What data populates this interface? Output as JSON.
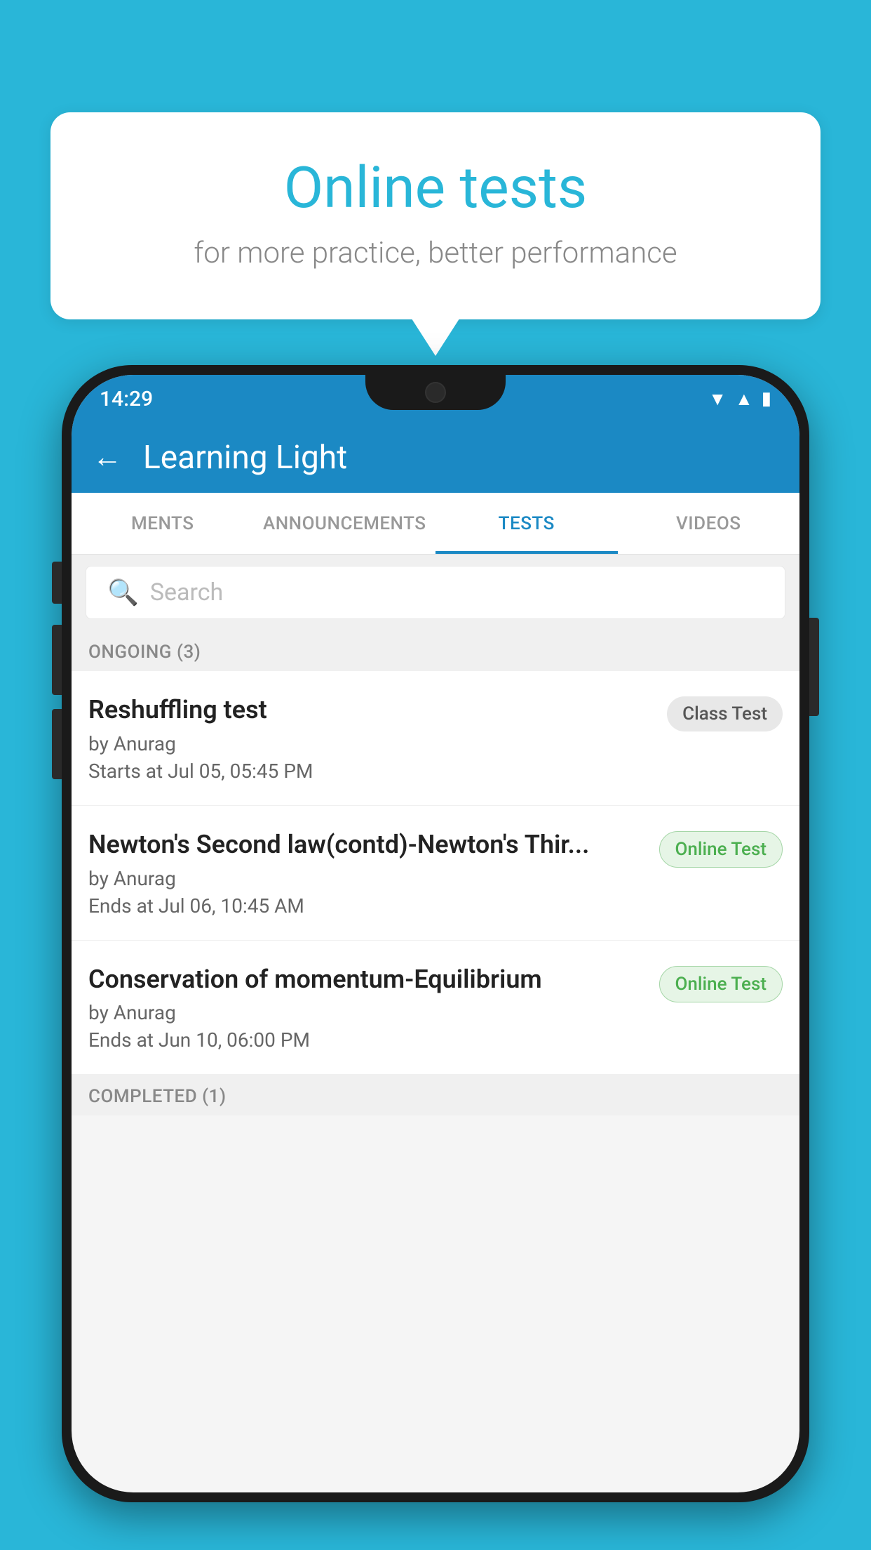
{
  "background_color": "#29b6d8",
  "bubble": {
    "title": "Online tests",
    "subtitle": "for more practice, better performance"
  },
  "status_bar": {
    "time": "14:29",
    "icons": [
      "wifi",
      "signal",
      "battery"
    ]
  },
  "header": {
    "title": "Learning Light",
    "back_label": "←"
  },
  "tabs": [
    {
      "label": "MENTS",
      "active": false
    },
    {
      "label": "ANNOUNCEMENTS",
      "active": false
    },
    {
      "label": "TESTS",
      "active": true
    },
    {
      "label": "VIDEOS",
      "active": false
    }
  ],
  "search": {
    "placeholder": "Search"
  },
  "sections": [
    {
      "title": "ONGOING (3)",
      "tests": [
        {
          "name": "Reshuffling test",
          "author": "by Anurag",
          "time_label": "Starts at",
          "time": "Jul 05, 05:45 PM",
          "badge": "Class Test",
          "badge_type": "class"
        },
        {
          "name": "Newton's Second law(contd)-Newton's Thir...",
          "author": "by Anurag",
          "time_label": "Ends at",
          "time": "Jul 06, 10:45 AM",
          "badge": "Online Test",
          "badge_type": "online"
        },
        {
          "name": "Conservation of momentum-Equilibrium",
          "author": "by Anurag",
          "time_label": "Ends at",
          "time": "Jun 10, 06:00 PM",
          "badge": "Online Test",
          "badge_type": "online"
        }
      ]
    }
  ],
  "completed_section_title": "COMPLETED (1)"
}
